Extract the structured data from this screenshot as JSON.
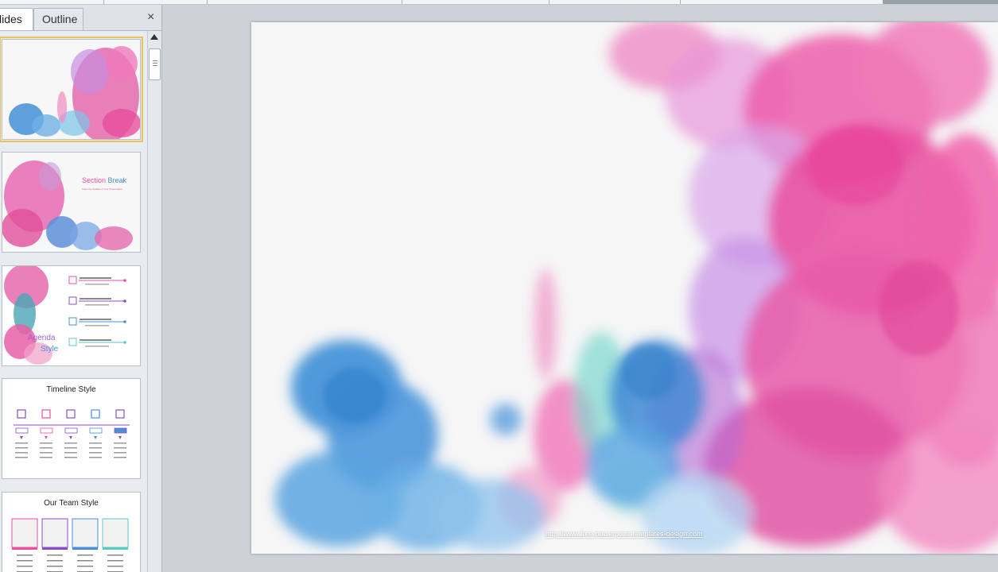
{
  "panel": {
    "tabs": [
      {
        "label": "lides"
      },
      {
        "label": "Outline"
      }
    ],
    "close_glyph": "×"
  },
  "thumbnails": [
    {
      "index": 1,
      "selected": true
    },
    {
      "index": 2,
      "title": "Section",
      "title2": "Break",
      "subtitle": "Insert the Subtitle of Your Presentation"
    },
    {
      "index": 3,
      "title": "Agenda",
      "title2": "Style"
    },
    {
      "index": 4,
      "title": "Timeline Style"
    },
    {
      "index": 5,
      "title": "Our Team Style"
    }
  ],
  "slide": {
    "footer_link": "http://www.free-powerpoint-templates-design.com"
  },
  "colors": {
    "pink": "#e8519f",
    "blue": "#4a8fd6",
    "purple": "#8a4fc4",
    "teal": "#5cc9c2",
    "selected_outline": "#e8c25a"
  }
}
